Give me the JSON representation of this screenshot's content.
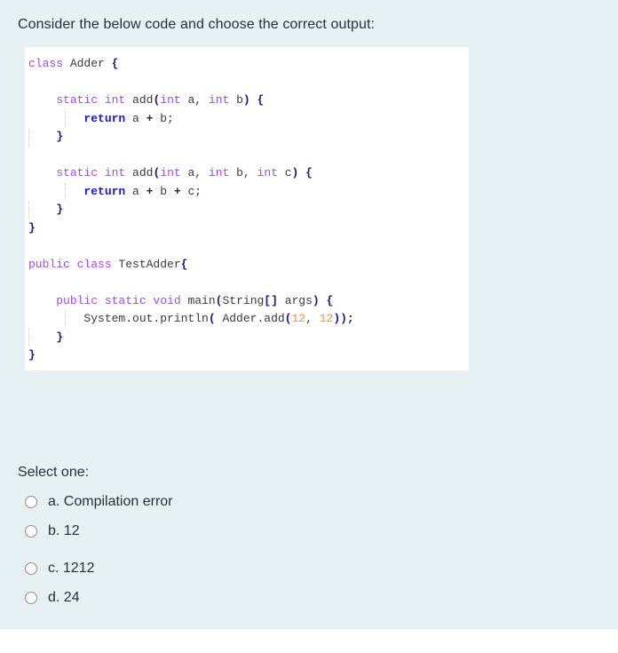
{
  "question": {
    "text": "Consider the below code and choose the correct output:"
  },
  "code": {
    "language": "java",
    "lines": [
      [
        {
          "t": "class ",
          "c": "kw"
        },
        {
          "t": "Adder ",
          "c": "id"
        },
        {
          "t": "{",
          "c": "brace"
        }
      ],
      [],
      [
        {
          "t": "    ",
          "c": "id"
        },
        {
          "t": "static int ",
          "c": "kw"
        },
        {
          "t": "add",
          "c": "id"
        },
        {
          "t": "(",
          "c": "punct"
        },
        {
          "t": "int ",
          "c": "kw"
        },
        {
          "t": "a, ",
          "c": "id"
        },
        {
          "t": "int ",
          "c": "kw"
        },
        {
          "t": "b",
          "c": "id"
        },
        {
          "t": ") {",
          "c": "punct"
        }
      ],
      [
        {
          "t": "        ",
          "c": "id"
        },
        {
          "t": "return",
          "c": "kw-ret"
        },
        {
          "t": " a ",
          "c": "id"
        },
        {
          "t": "+",
          "c": "op"
        },
        {
          "t": " b;",
          "c": "id"
        }
      ],
      [
        {
          "t": "    ",
          "c": "id"
        },
        {
          "t": "}",
          "c": "brace"
        }
      ],
      [],
      [
        {
          "t": "    ",
          "c": "id"
        },
        {
          "t": "static int ",
          "c": "kw"
        },
        {
          "t": "add",
          "c": "id"
        },
        {
          "t": "(",
          "c": "punct"
        },
        {
          "t": "int ",
          "c": "kw"
        },
        {
          "t": "a, ",
          "c": "id"
        },
        {
          "t": "int ",
          "c": "kw"
        },
        {
          "t": "b, ",
          "c": "id"
        },
        {
          "t": "int ",
          "c": "kw"
        },
        {
          "t": "c",
          "c": "id"
        },
        {
          "t": ") {",
          "c": "punct"
        }
      ],
      [
        {
          "t": "        ",
          "c": "id"
        },
        {
          "t": "return",
          "c": "kw-ret"
        },
        {
          "t": " a ",
          "c": "id"
        },
        {
          "t": "+",
          "c": "op"
        },
        {
          "t": " b ",
          "c": "id"
        },
        {
          "t": "+",
          "c": "op"
        },
        {
          "t": " c;",
          "c": "id"
        }
      ],
      [
        {
          "t": "    ",
          "c": "id"
        },
        {
          "t": "}",
          "c": "brace"
        }
      ],
      [
        {
          "t": "}",
          "c": "brace"
        }
      ],
      [],
      [
        {
          "t": "public class ",
          "c": "kw"
        },
        {
          "t": "TestAdder",
          "c": "id"
        },
        {
          "t": "{",
          "c": "brace"
        }
      ],
      [],
      [
        {
          "t": "    ",
          "c": "id"
        },
        {
          "t": "public static void ",
          "c": "kw"
        },
        {
          "t": "main",
          "c": "id"
        },
        {
          "t": "(",
          "c": "punct"
        },
        {
          "t": "String",
          "c": "id"
        },
        {
          "t": "[]",
          "c": "punct"
        },
        {
          "t": " args",
          "c": "id"
        },
        {
          "t": ") {",
          "c": "punct"
        }
      ],
      [
        {
          "t": "        System.out.println",
          "c": "id"
        },
        {
          "t": "(",
          "c": "punct"
        },
        {
          "t": " Adder.add",
          "c": "id"
        },
        {
          "t": "(",
          "c": "punct"
        },
        {
          "t": "12",
          "c": "num"
        },
        {
          "t": ", ",
          "c": "id"
        },
        {
          "t": "12",
          "c": "num"
        },
        {
          "t": "));",
          "c": "punct"
        }
      ],
      [
        {
          "t": "    ",
          "c": "id"
        },
        {
          "t": "}",
          "c": "brace"
        }
      ],
      [
        {
          "t": "}",
          "c": "brace"
        }
      ]
    ]
  },
  "answers": {
    "prompt": "Select one:",
    "options": [
      {
        "id": "a",
        "label": "a. Compilation error",
        "selected": false
      },
      {
        "id": "b",
        "label": "b. 12",
        "selected": false
      },
      {
        "id": "c",
        "label": "c. 1212",
        "selected": false
      },
      {
        "id": "d",
        "label": "d. 24",
        "selected": false
      }
    ]
  },
  "colors": {
    "page_background": "#e7f1f3",
    "code_background": "#ffffff",
    "text": "#23313a",
    "keyword": "#a945f7",
    "return_keyword": "#1818c8",
    "brace": "#1a1a8c",
    "number": "#f59234",
    "identifier": "#3a3a3a",
    "radio_border": "#8d8d8d"
  }
}
